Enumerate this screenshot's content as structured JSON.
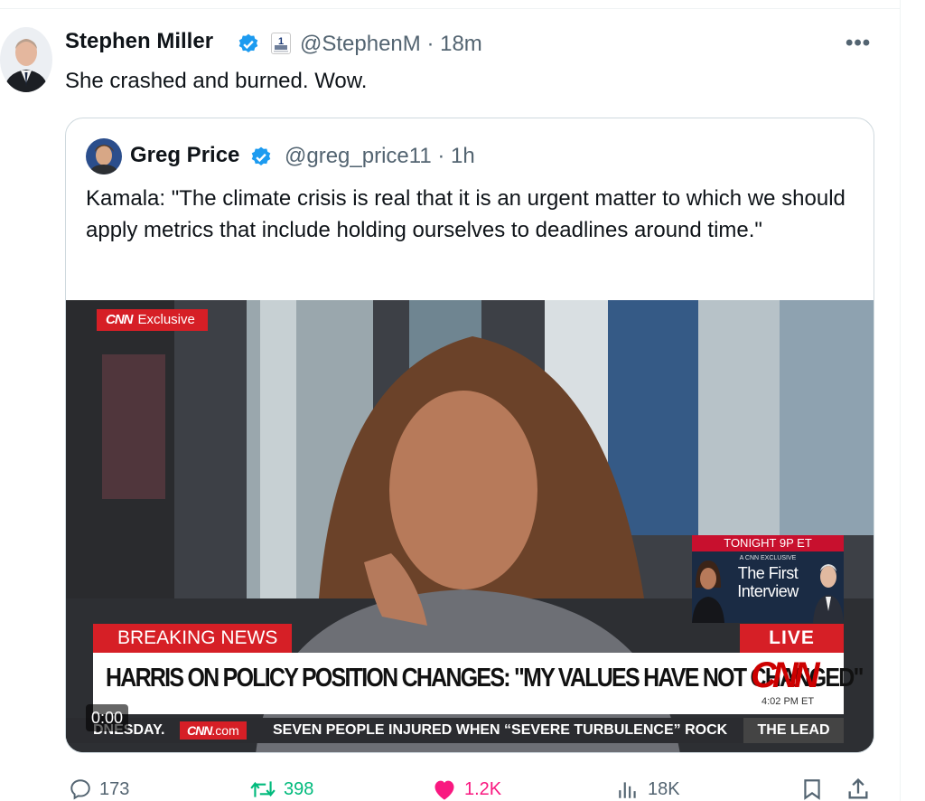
{
  "tweet": {
    "author_name": "Stephen Miller",
    "author_handle": "@StephenM · 18m",
    "text": "She crashed and burned. Wow.",
    "more_label": "•••"
  },
  "quoted": {
    "author_name": "Greg Price",
    "author_handle": "@greg_price11 · 1h",
    "text": "Kamala: \"The climate crisis is real that it is an urgent matter to which we should apply metrics that include holding ourselves to deadlines around time.\""
  },
  "video": {
    "timestamp": "0:00",
    "cnn_tag_logo": "CNN",
    "cnn_tag": "Exclusive",
    "promo_top": "TONIGHT 9P ET",
    "promo_small": "A CNN EXCLUSIVE",
    "promo_title": "The First Interview",
    "breaking": "BREAKING NEWS",
    "live": "LIVE",
    "headline": "HARRIS ON POLICY POSITION CHANGES: \"MY VALUES HAVE NOT CHANGED\"",
    "logo": "CNN",
    "time_et": "4:02 PM ET",
    "ticker_left": "DNESDAY.",
    "ticker_site_logo": "CNN",
    "ticker_site": ".com",
    "ticker_text": "SEVEN PEOPLE INJURED WHEN “SEVERE TURBULENCE” ROCK",
    "show": "THE LEAD"
  },
  "actions": {
    "replies": "173",
    "reposts": "398",
    "likes": "1.2K",
    "views": "18K",
    "reply_icon": "reply-icon",
    "repost_icon": "repost-icon",
    "like_icon": "heart-icon",
    "views_icon": "views-icon",
    "bookmark_icon": "bookmark-icon",
    "share_icon": "share-icon"
  },
  "colors": {
    "text": "#0f1419",
    "secondary": "#536471",
    "verified": "#1d9bf0",
    "repost": "#00ba7c",
    "like": "#f91880",
    "cnn_red": "#d61f26"
  }
}
